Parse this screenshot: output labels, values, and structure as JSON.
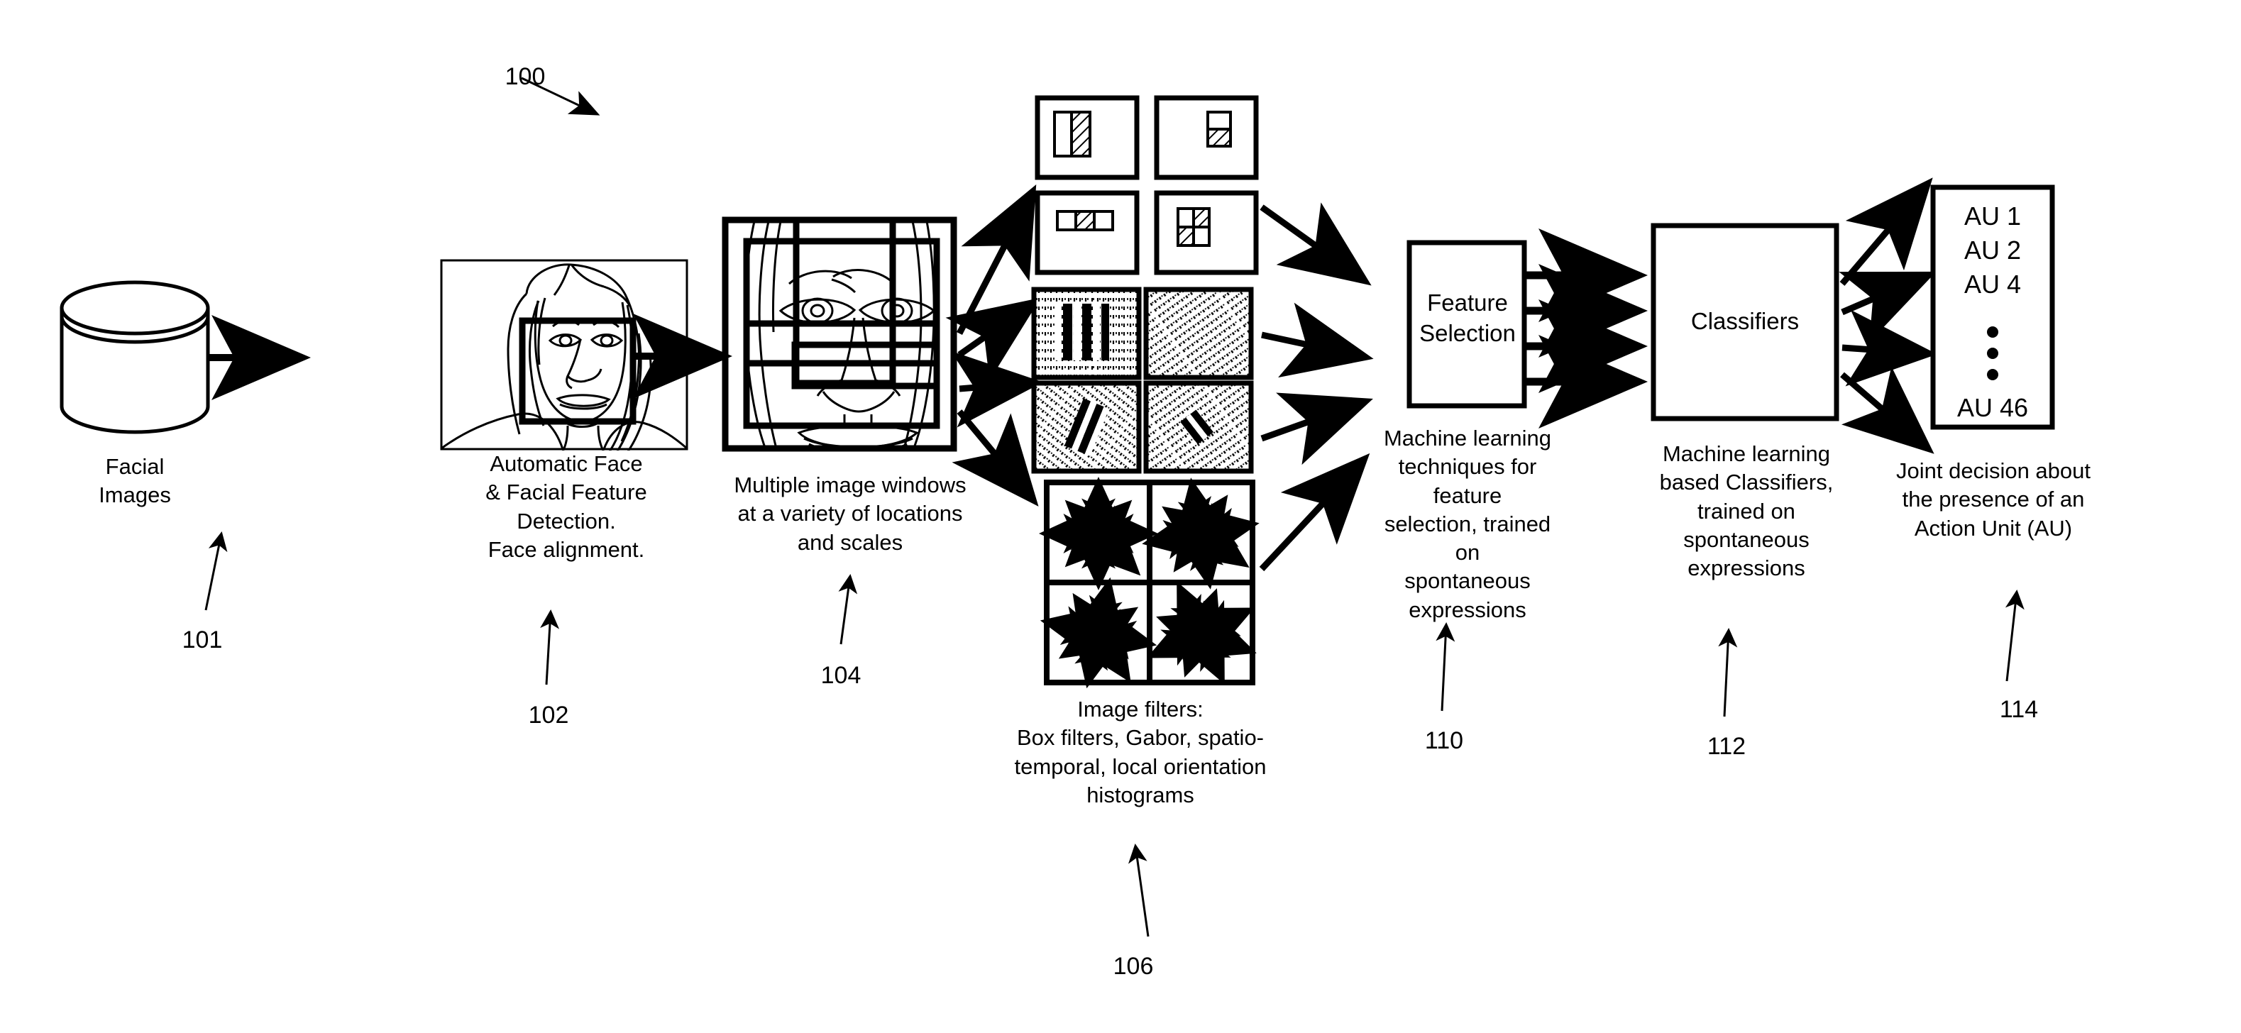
{
  "figure": {
    "ref_main": "100",
    "title_present": false
  },
  "stages": [
    {
      "id": "facial-images",
      "caption": "Facial\nImages",
      "ref": "101",
      "icon": "database-cylinder-icon"
    },
    {
      "id": "face-detection",
      "caption": "Automatic Face\n& Facial Feature\nDetection.\nFace alignment.",
      "ref": "102",
      "icon": "face-photo-with-detection-box-icon"
    },
    {
      "id": "image-windows",
      "caption": "Multiple image windows\nat a variety of locations\nand scales",
      "ref": "104",
      "icon": "face-photo-with-window-grid-icon"
    },
    {
      "id": "image-filters",
      "caption": "Image filters:\nBox filters, Gabor, spatio-\ntemporal, local orientation\nhistograms",
      "ref": "106",
      "icon": "filter-tiles-icon"
    },
    {
      "id": "feature-selection",
      "box_label": "Feature\nSelection",
      "caption": "Machine learning\ntechniques for feature\nselection, trained on\nspontaneous\nexpressions",
      "ref": "110",
      "icon": "process-box-icon"
    },
    {
      "id": "classifiers",
      "box_label": "Classifiers",
      "caption": "Machine learning\nbased Classifiers,\ntrained on\nspontaneous\nexpressions",
      "ref": "112",
      "icon": "process-box-icon"
    },
    {
      "id": "action-units",
      "caption": "Joint decision about\nthe presence of an\nAction Unit (AU)",
      "ref": "114",
      "icon": "action-unit-list-icon"
    }
  ],
  "action_units": {
    "items": [
      "AU 1",
      "AU 2",
      "AU 4"
    ],
    "ellipsis": "vertical-dots",
    "last": "AU 46"
  },
  "filter_groups": [
    {
      "name": "box-filters",
      "tiles": [
        "haar-two-rect-vertical",
        "haar-two-rect-horizontal-small",
        "haar-three-rect-horizontal",
        "haar-four-rect-checker"
      ]
    },
    {
      "name": "gabor-filters",
      "tiles": [
        "gabor-vertical",
        "gabor-diagonal-fine",
        "gabor-diagonal-left",
        "gabor-diagonal-right"
      ]
    },
    {
      "name": "orientation-histograms",
      "tiles": [
        "starburst-1",
        "starburst-2",
        "starburst-3",
        "starburst-4"
      ]
    }
  ],
  "colors": {
    "ink": "#000000",
    "paper": "#ffffff"
  }
}
